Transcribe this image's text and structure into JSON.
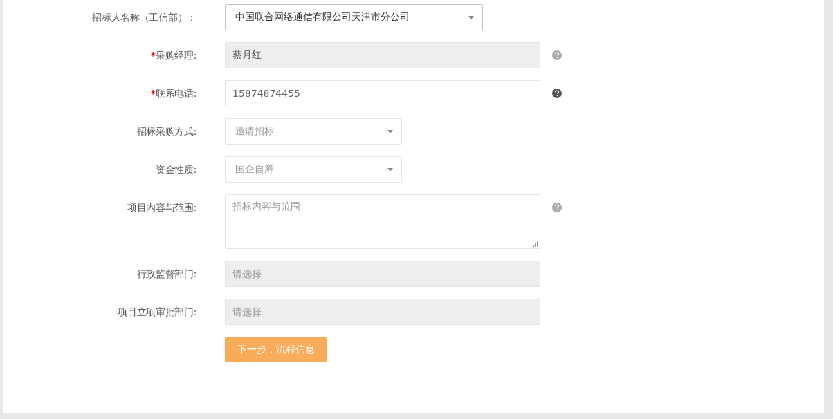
{
  "fields": [
    {
      "label": "招标人名称（工信部）：",
      "kind": "select",
      "value": "中国联合网络通信有限公司天津市分公司",
      "disabled": false
    },
    {
      "marker": "*",
      "label": "采购经理:",
      "kind": "text",
      "value": "蔡月红",
      "disabled": true,
      "help": true,
      "help_dark": false
    },
    {
      "marker": "*",
      "label": "联系电话:",
      "kind": "text",
      "value": "15874874455",
      "disabled": false,
      "help": true,
      "help_dark": true
    },
    {
      "label": "招标采购方式:",
      "kind": "select",
      "value": "邀请招标",
      "disabled": true
    },
    {
      "label": "资金性质:",
      "kind": "select",
      "value": "国企自筹",
      "disabled": true
    },
    {
      "label": "项目内容与范围:",
      "kind": "textarea",
      "placeholder": "招标内容与范围",
      "disabled": false,
      "help": true,
      "help_dark": false
    },
    {
      "label": "行政监督部门:",
      "kind": "text",
      "placeholder": "请选择",
      "disabled": true
    },
    {
      "label": "项目立项审批部门:",
      "kind": "text",
      "placeholder": "请选择",
      "disabled": true
    }
  ],
  "submit_button": "下一步，流程信息"
}
